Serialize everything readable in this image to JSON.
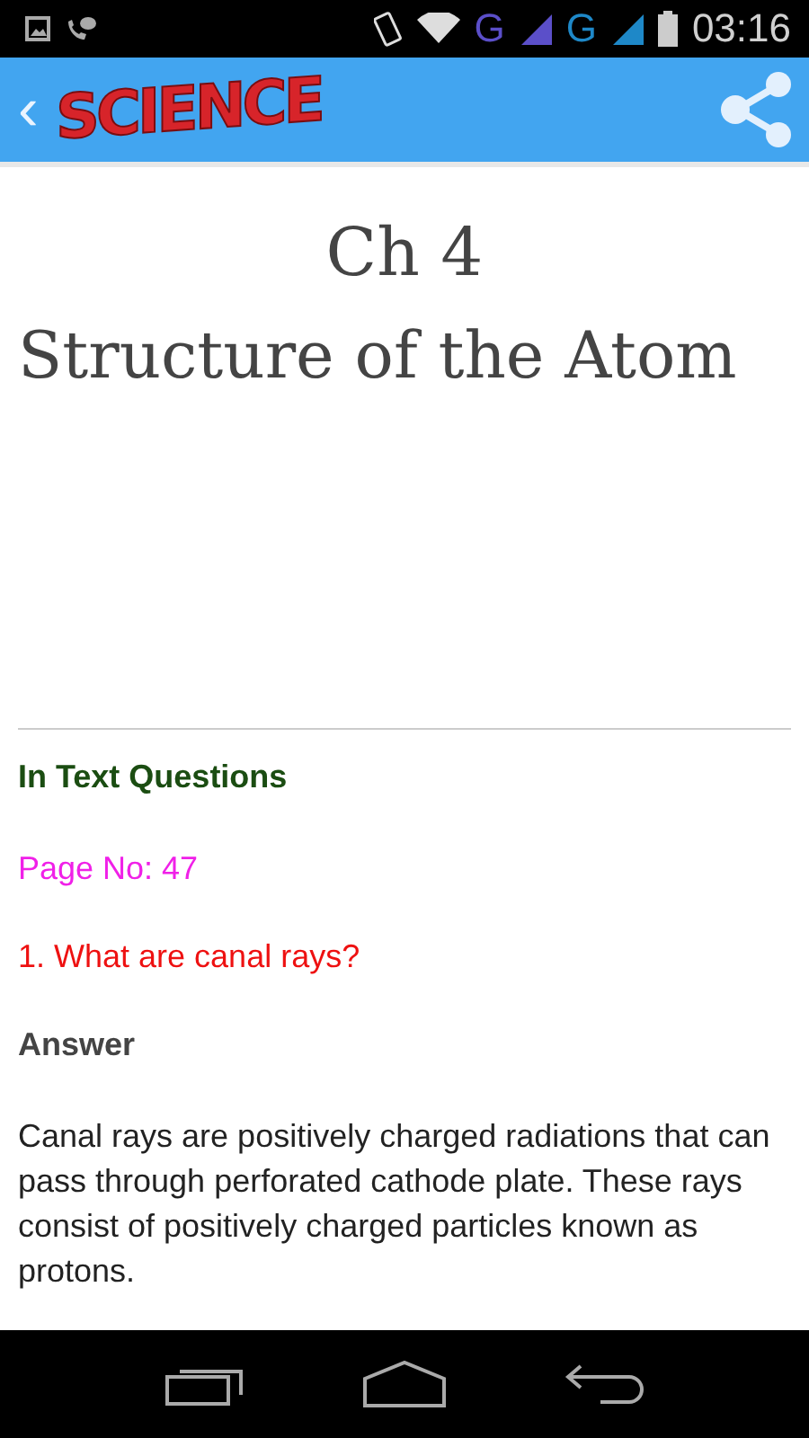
{
  "status_bar": {
    "network_1": "G",
    "network_2": "G",
    "time": "03:16"
  },
  "header": {
    "back": "‹",
    "logo": "SCIENCE"
  },
  "chapter": {
    "number": "Ch 4",
    "title": "Structure of the Atom"
  },
  "content": [
    {
      "kind": "heading",
      "text": "In Text Questions"
    },
    {
      "kind": "page",
      "text": "Page No: 47"
    },
    {
      "kind": "question",
      "text": "1. What are canal rays?"
    },
    {
      "kind": "label",
      "text": "Answer"
    },
    {
      "kind": "body",
      "text": "Canal rays are positively charged radiations that can pass through perforated cathode plate. These rays consist of positively charged particles known as protons."
    }
  ]
}
